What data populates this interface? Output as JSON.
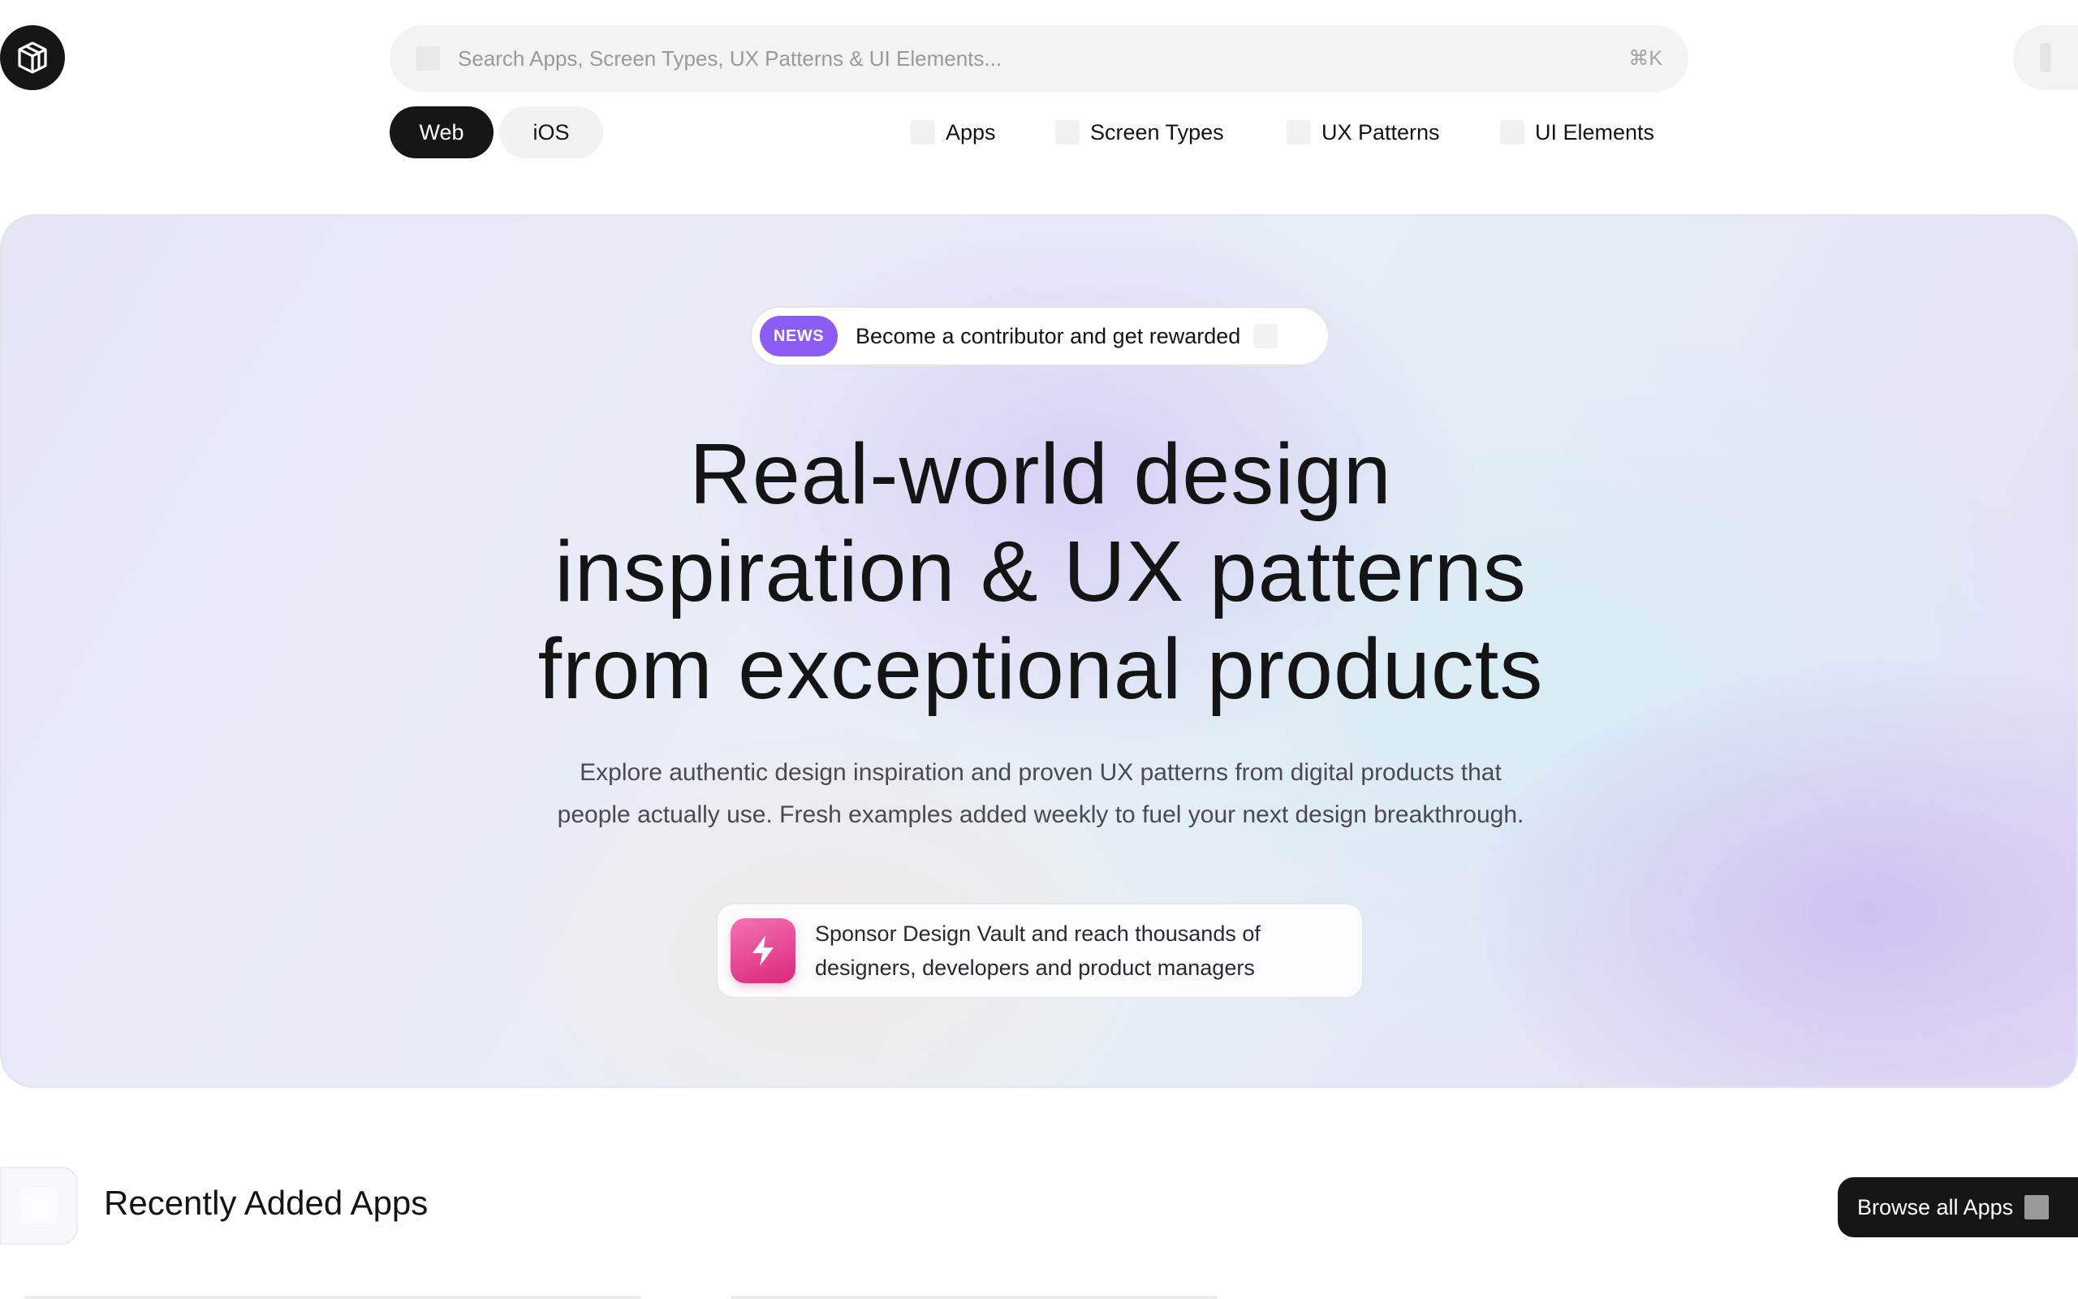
{
  "header": {
    "search_placeholder": "Search Apps, Screen Types, UX Patterns & UI Elements...",
    "search_shortcut": "⌘K",
    "platform_tabs": [
      {
        "label": "Web",
        "selected": true
      },
      {
        "label": "iOS",
        "selected": false
      }
    ],
    "nav": [
      "Apps",
      "Screen Types",
      "UX Patterns",
      "UI Elements"
    ]
  },
  "hero": {
    "news_badge": "NEWS",
    "news_text": "Become a contributor and get rewarded",
    "headline_lines": [
      "Real-world design",
      "inspiration & UX patterns",
      "from exceptional products"
    ],
    "subtitle_lines": [
      "Explore authentic design inspiration and proven UX patterns from digital products that",
      "people actually use. Fresh examples added weekly to fuel your next design breakthrough."
    ],
    "sponsor_lines": [
      "Sponsor Design Vault and reach thousands of",
      "designers, developers and product managers"
    ]
  },
  "recent": {
    "title": "Recently Added Apps",
    "browse_label": "Browse all Apps"
  },
  "colors": {
    "accent_dark": "#161616",
    "news_badge": "#8b5cf6",
    "sponsor_icon": "#db2777"
  },
  "icons": {
    "logo": "cube-logo-icon",
    "sponsor": "lightning-bolt-icon"
  }
}
